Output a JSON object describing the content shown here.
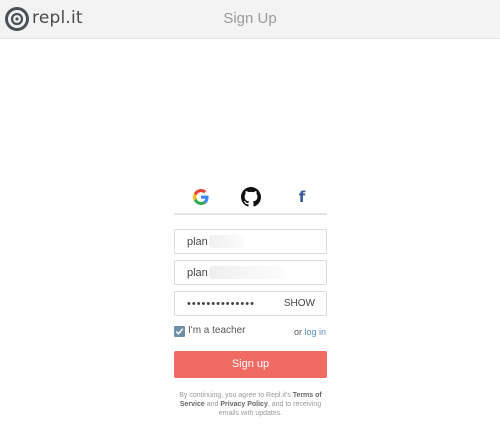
{
  "header": {
    "logo_text": "repl.it",
    "title": "Sign Up"
  },
  "social": {
    "google_icon": "google-icon",
    "github_icon": "github-icon",
    "facebook_icon": "facebook-icon",
    "facebook_glyph": "f"
  },
  "form": {
    "username_value": "plan",
    "email_value": "plan",
    "password_value": "••••••••••••••",
    "show_label": "SHOW",
    "teacher_label": "I'm a teacher",
    "teacher_checked": true,
    "or_text": "or",
    "login_link": "log in",
    "signup_label": "Sign up"
  },
  "terms": {
    "pre": "By continuing, you agree to Repl.it's",
    "terms_link": "Terms of Service",
    "and": "and",
    "privacy_link": "Privacy Policy",
    "post": ", and to receiving emails with updates."
  },
  "colors": {
    "accent_button": "#f06b63",
    "link": "#5b8db8",
    "checkbox": "#6f8fa6",
    "facebook": "#3b5998"
  }
}
